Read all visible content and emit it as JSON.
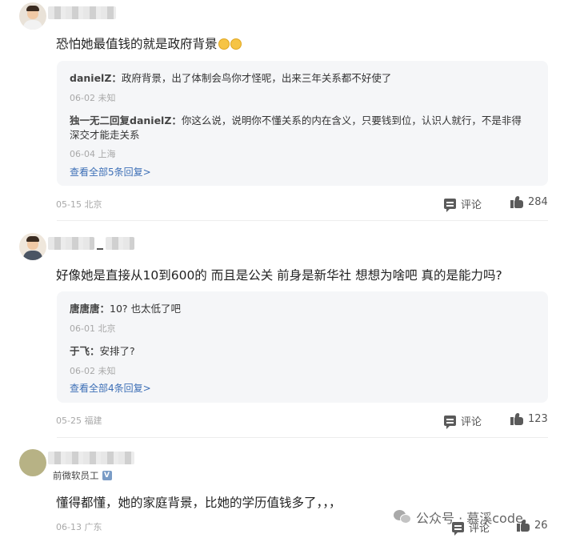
{
  "comments": [
    {
      "text": "恐怕她最值钱的就是政府背景",
      "replies": [
        {
          "author": "danielZ：",
          "text": "政府背景，出了体制会鸟你才怪呢，出来三年关系都不好使了",
          "date": "06-02",
          "location": "未知"
        },
        {
          "author": "独一无二回复danielZ：",
          "text": "你这么说，说明你不懂关系的内在含义，只要钱到位，认识人就行，不是非得",
          "text2": "深交才能走关系",
          "date": "06-04",
          "location": "上海"
        }
      ],
      "view_all": "查看全部5条回复>",
      "date": "05-15",
      "location": "北京",
      "comment_label": "评论",
      "likes": "284"
    },
    {
      "text": "好像她是直接从10到600的 而且是公关 前身是新华社 想想为啥吧 真的是能力吗?",
      "replies": [
        {
          "author": "唐唐唐：",
          "text": "10? 也太低了吧",
          "date": "06-01",
          "location": "北京"
        },
        {
          "author": "于飞：",
          "text": "安排了?",
          "date": "06-02",
          "location": "未知"
        }
      ],
      "view_all": "查看全部4条回复>",
      "date": "05-25",
      "location": "福建",
      "comment_label": "评论",
      "likes": "123"
    },
    {
      "badge": "前微软员工",
      "badge_icon": "V",
      "text": "懂得都懂，她的家庭背景，比她的学历值钱多了，，，",
      "date": "06-13",
      "location": "广东",
      "comment_label": "评论",
      "likes": "26"
    }
  ],
  "watermark": "公众号 · 慕溪code",
  "colors": {
    "link": "#3d6fb6",
    "meta": "#a8a8a8",
    "reply_bg": "#f5f6f8"
  }
}
